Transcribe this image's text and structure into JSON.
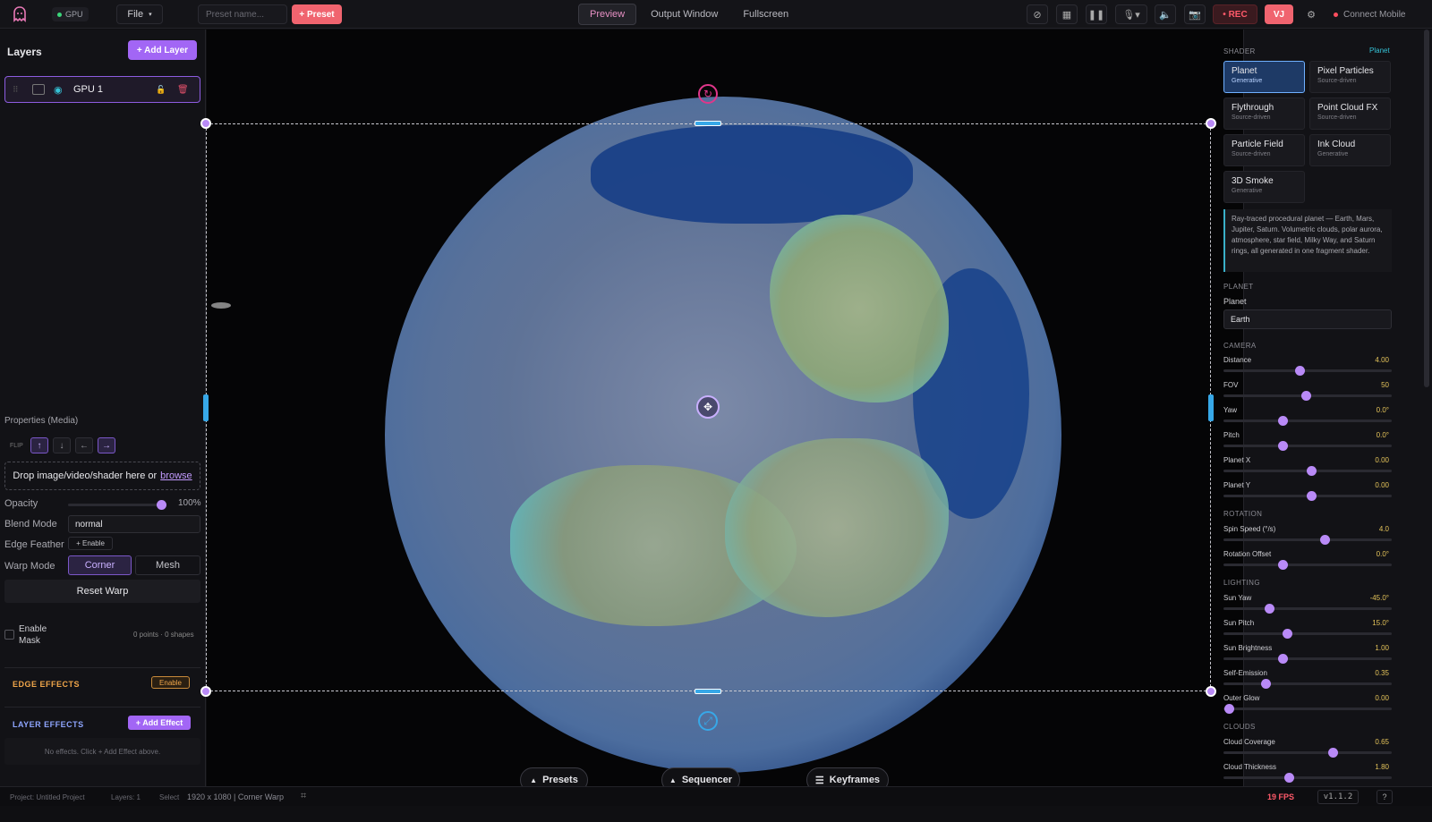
{
  "topbar": {
    "gpu_label": "GPU",
    "file_label": "File",
    "preset_placeholder": "Preset name...",
    "preset_button": "+ Preset",
    "tabs": [
      {
        "label": "Preview",
        "active": true
      },
      {
        "label": "Output Window",
        "active": false
      },
      {
        "label": "Fullscreen",
        "active": false
      }
    ],
    "rec_label": "• REC",
    "vj_label": "VJ",
    "connect_label": "Connect Mobile"
  },
  "layers": {
    "title": "Layers",
    "add_button": "+ Add Layer",
    "items": [
      {
        "name": "GPU 1"
      }
    ]
  },
  "properties": {
    "title": "Properties (Media)",
    "flip_label": "FLIP",
    "flip_icons": [
      "↑",
      "↓",
      "←",
      "→"
    ],
    "drop_text": "Drop image/video/shader here or",
    "drop_link": "browse",
    "opacity_label": "Opacity",
    "opacity_value": "100%",
    "opacity_fraction": 1.0,
    "blend_label": "Blend Mode",
    "blend_value": "normal",
    "feather_label": "Edge Feather",
    "feather_button": "+ Enable",
    "warp_label": "Warp Mode",
    "warp_options": [
      "Corner",
      "Mesh"
    ],
    "warp_selected": "Corner",
    "reset_warp": "Reset Warp",
    "mask_label": "Enable Mask",
    "mask_info": "0 points · 0 shapes",
    "edge_effects": "EDGE EFFECTS",
    "edge_enable": "Enable",
    "layer_effects": "LAYER EFFECTS",
    "add_effect": "+ Add Effect",
    "no_effects": "No effects. Click + Add Effect above."
  },
  "canvas": {
    "bottom_buttons": [
      {
        "label": "Presets",
        "icon": "▲"
      },
      {
        "label": "Sequencer",
        "icon": "▲"
      },
      {
        "label": "Keyframes",
        "icon": "☰"
      }
    ]
  },
  "shader": {
    "section": "SHADER",
    "current": "Planet",
    "cards": [
      {
        "name": "Planet",
        "sub": "Generative",
        "active": true
      },
      {
        "name": "Pixel Particles",
        "sub": "Source-driven",
        "active": false
      },
      {
        "name": "Flythrough",
        "sub": "Source-driven",
        "active": false
      },
      {
        "name": "Point Cloud FX",
        "sub": "Source-driven",
        "active": false
      },
      {
        "name": "Particle Field",
        "sub": "Source-driven",
        "active": false
      },
      {
        "name": "Ink Cloud",
        "sub": "Generative",
        "active": false
      },
      {
        "name": "3D Smoke",
        "sub": "Generative",
        "active": false
      }
    ],
    "description": "Ray-traced procedural planet — Earth, Mars, Jupiter, Saturn. Volumetric clouds, polar aurora, atmosphere, star field, Milky Way, and Saturn rings, all generated in one fragment shader.",
    "planet_section": "PLANET",
    "planet_label": "Planet",
    "planet_value": "Earth",
    "camera_section": "CAMERA",
    "camera": [
      {
        "label": "Distance",
        "value": "4.00",
        "pos": 0.45
      },
      {
        "label": "FOV",
        "value": "50",
        "pos": 0.49
      },
      {
        "label": "Yaw",
        "value": "0.0°",
        "pos": 0.35
      },
      {
        "label": "Pitch",
        "value": "0.0°",
        "pos": 0.35
      },
      {
        "label": "Planet X",
        "value": "0.00",
        "pos": 0.52
      },
      {
        "label": "Planet Y",
        "value": "0.00",
        "pos": 0.52
      }
    ],
    "rotation_section": "ROTATION",
    "rotation": [
      {
        "label": "Spin Speed (°/s)",
        "value": "4.0",
        "pos": 0.6
      },
      {
        "label": "Rotation Offset",
        "value": "0.0°",
        "pos": 0.35
      }
    ],
    "lighting_section": "LIGHTING",
    "lighting": [
      {
        "label": "Sun Yaw",
        "value": "-45.0°",
        "pos": 0.27
      },
      {
        "label": "Sun Pitch",
        "value": "15.0°",
        "pos": 0.38
      },
      {
        "label": "Sun Brightness",
        "value": "1.00",
        "pos": 0.35
      },
      {
        "label": "Self-Emission",
        "value": "0.35",
        "pos": 0.25
      },
      {
        "label": "Outer Glow",
        "value": "0.00",
        "pos": 0.03
      }
    ],
    "clouds_section": "CLOUDS",
    "clouds": [
      {
        "label": "Cloud Coverage",
        "value": "0.65",
        "pos": 0.65
      },
      {
        "label": "Cloud Thickness",
        "value": "1.80",
        "pos": 0.39
      }
    ]
  },
  "status": {
    "project": "Project: Untitled Project",
    "layers": "Layers: 1",
    "select": "Select",
    "resolution": "1920 x 1080 | Corner Warp",
    "fps": "19 FPS",
    "version": "v1.1.2",
    "help": "?"
  },
  "colors": {
    "accent": "#a266f5",
    "preset": "#f0646f",
    "rec": "#ff5a6a",
    "handle": "#37a8e8",
    "value": "#e4c35a"
  }
}
